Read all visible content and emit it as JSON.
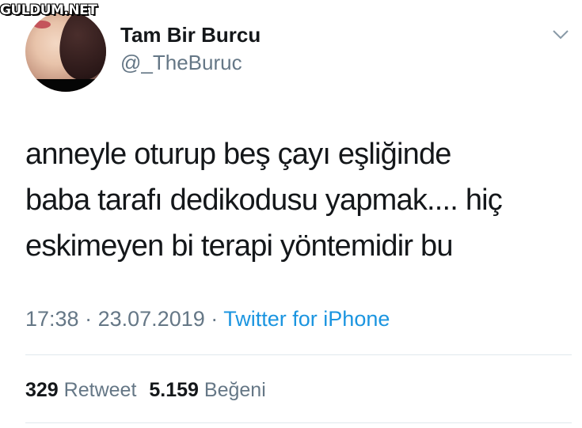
{
  "watermark": "GULDUM.NET",
  "tweet": {
    "author": {
      "display_name": "Tam Bir Burcu",
      "handle": "@_TheBuruc"
    },
    "text_lines": [
      "anneyle oturup beş çayı eşliğinde",
      "baba tarafı dedikodusu yapmak.... hiç",
      "eskimeyen bi terapi yöntemidir bu"
    ],
    "time": "17:38",
    "separator": "·",
    "date": "23.07.2019",
    "source": "Twitter for iPhone",
    "stats": {
      "retweet_count": "329",
      "retweet_label": "Retweet",
      "like_count": "5.159",
      "like_label": "Beğeni"
    },
    "menu_icon": "chevron-down-icon"
  },
  "colors": {
    "text": "#14171a",
    "secondary": "#657786",
    "link": "#1b95e0",
    "divider": "#e1e8ed"
  }
}
